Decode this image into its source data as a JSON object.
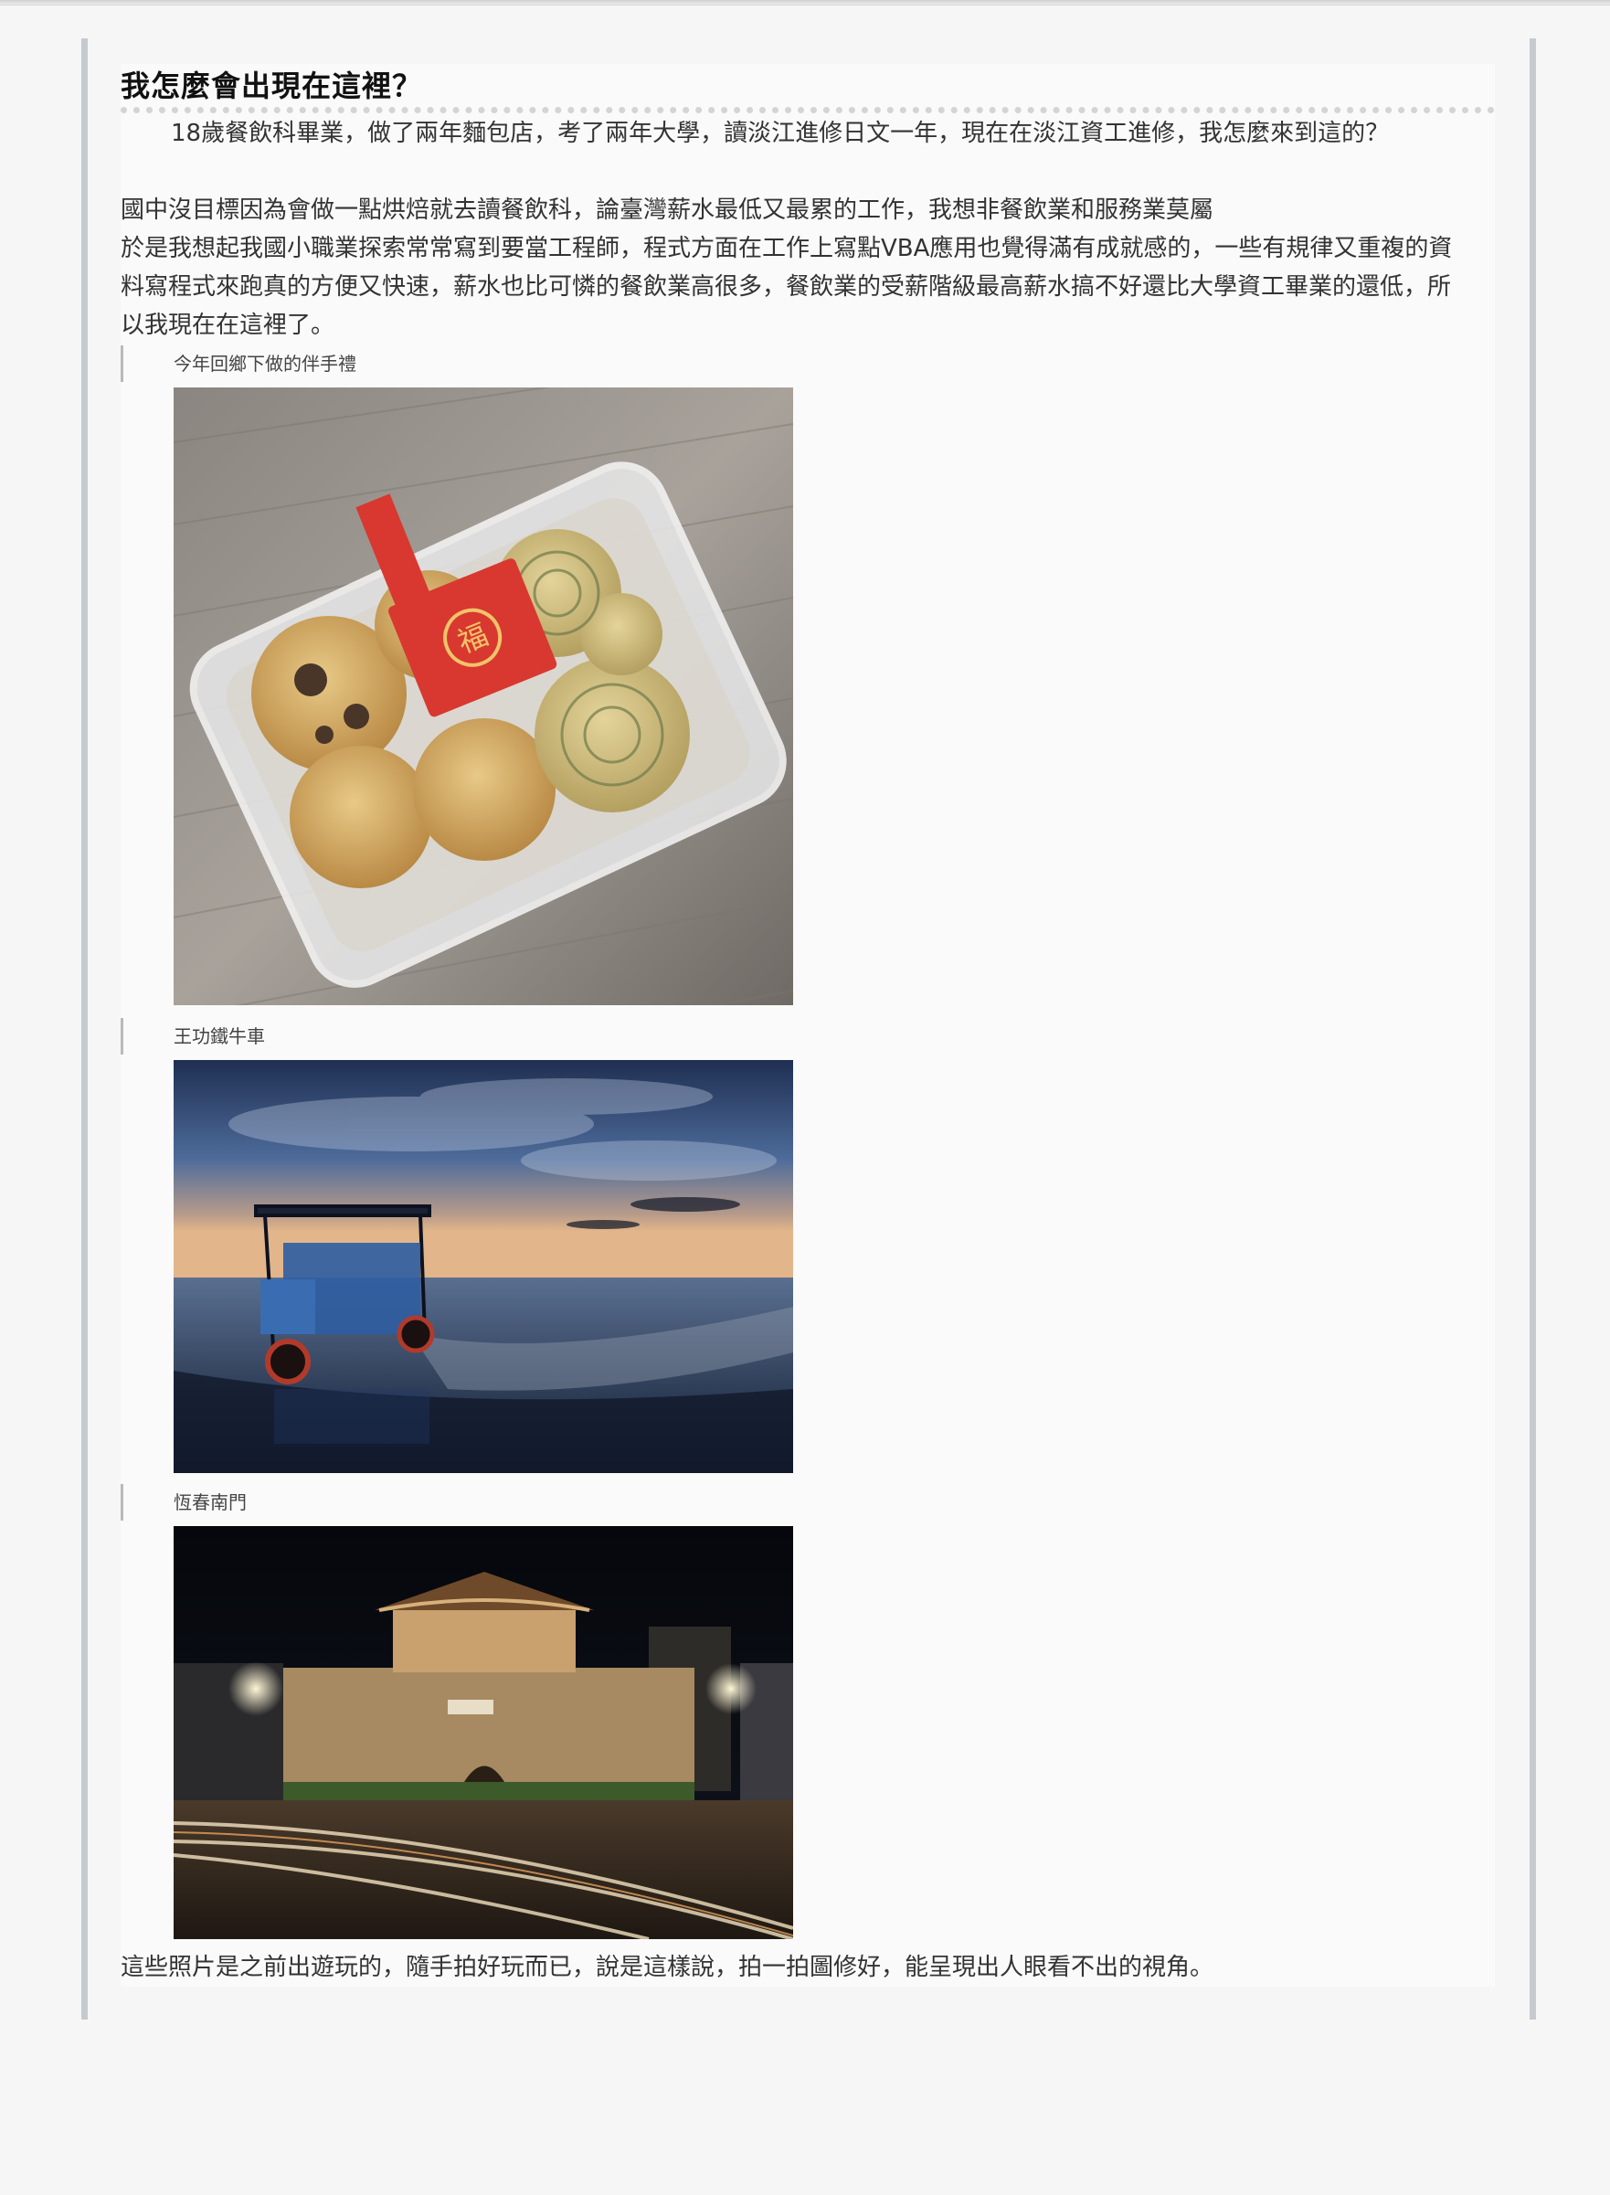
{
  "article": {
    "title": "我怎麼會出現在這裡？",
    "paragraphs": [
      "18歲餐飲科畢業，做了兩年麵包店，考了兩年大學，讀淡江進修日文一年，現在在淡江資工進修，我怎麼來到這的？",
      "國中沒目標因為會做一點烘焙就去讀餐飲科，論臺灣薪水最低又最累的工作，我想非餐飲業和服務業莫屬",
      "於是我想起我國小職業探索常常寫到要當工程師，程式方面在工作上寫點VBA應用也覺得滿有成就感的，一些有規律又重複的資料寫程式來跑真的方便又快速，薪水也比可憐的餐飲業高很多，餐飲業的受薪階級最高薪水搞不好還比大學資工畢業的還低，所以我現在在這裡了。"
    ],
    "figures": [
      {
        "caption": "今年回鄉下做的伴手禮",
        "icon": "cookies-photo"
      },
      {
        "caption": "王功鐵牛車",
        "icon": "tuk-tuk-photo"
      },
      {
        "caption": "恆春南門",
        "icon": "gate-photo"
      }
    ],
    "closing": "這些照片是之前出遊玩的，隨手拍好玩而已，說是這樣說，拍一拍圖修好，能呈現出人眼看不出的視角。",
    "sticker_text": "福"
  }
}
